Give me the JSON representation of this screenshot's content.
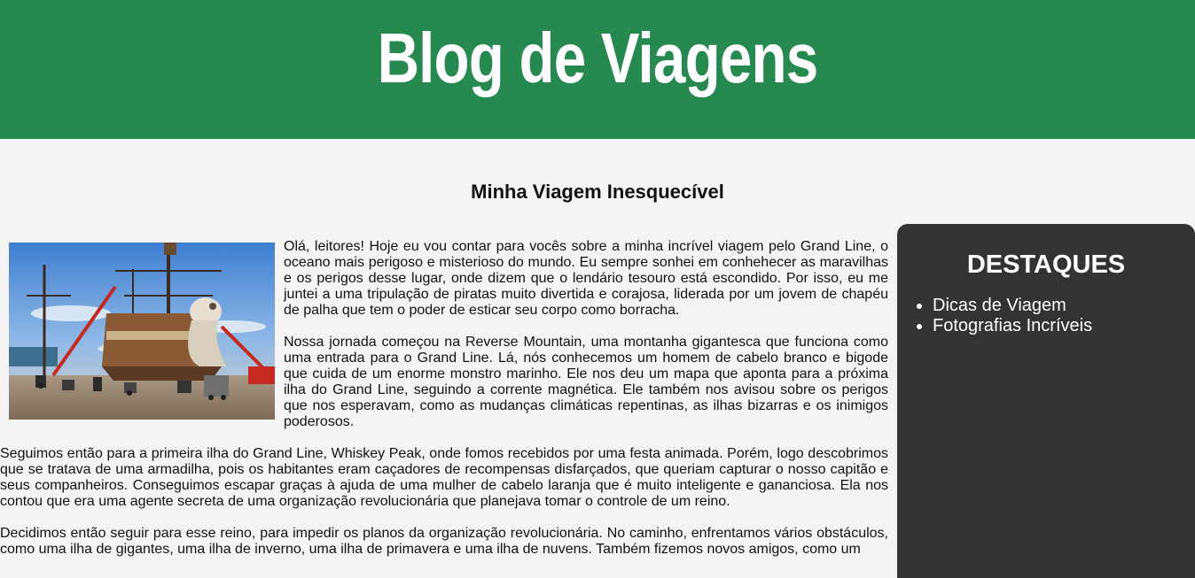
{
  "header": {
    "title": "Blog de Viagens",
    "bg_color": "#268950"
  },
  "post": {
    "title": "Minha Viagem Inesquecível",
    "paragraphs": [
      "Olá, leitores! Hoje eu vou contar para vocês sobre a minha incrível viagem pelo Grand Line, o oceano mais perigoso e misterioso do mundo. Eu sempre sonhei em conhehecer as maravilhas e os perigos desse lugar, onde dizem que o lendário tesouro está escondido. Por isso, eu me juntei a uma tripulação de piratas muito divertida e corajosa, liderada por um jovem de chapéu de palha que tem o poder de esticar seu corpo como borracha.",
      "Nossa jornada começou na Reverse Mountain, uma montanha gigantesca que funciona como uma entrada para o Grand Line. Lá, nós conhecemos um homem de cabelo branco e bigode que cuida de um enorme monstro marinho. Ele nos deu um mapa que aponta para a próxima ilha do Grand Line, seguindo a corrente magnética. Ele também nos avisou sobre os perigos que nos esperavam, como as mudanças climáticas repentinas, as ilhas bizarras e os inimigos poderosos.",
      "Seguimos então para a primeira ilha do Grand Line, Whiskey Peak, onde fomos recebidos por uma festa animada. Porém, logo descobrimos que se tratava de uma armadilha, pois os habitantes eram caçadores de recompensas disfarçados, que queriam capturar o nosso capitão e seus companheiros. Conseguimos escapar graças à ajuda de uma mulher de cabelo laranja que é muito inteligente e gananciosa. Ela nos contou que era uma agente secreta de uma organização revolucionária que planejava tomar o controle de um reino.",
      "Decidimos então seguir para esse reino, para impedir os planos da organização revolucionária. No caminho, enfrentamos vários obstáculos, como uma ilha de gigantes, uma ilha de inverno, uma ilha de primavera e uma ilha de nuvens. Também fizemos novos amigos, como um"
    ],
    "image": {
      "icon": "pirate-ship-photo"
    }
  },
  "sidebar": {
    "title": "DESTAQUES",
    "items": [
      {
        "label": "Dicas de Viagem"
      },
      {
        "label": "Fotografias Incríveis"
      }
    ],
    "bg_color": "#333333"
  }
}
